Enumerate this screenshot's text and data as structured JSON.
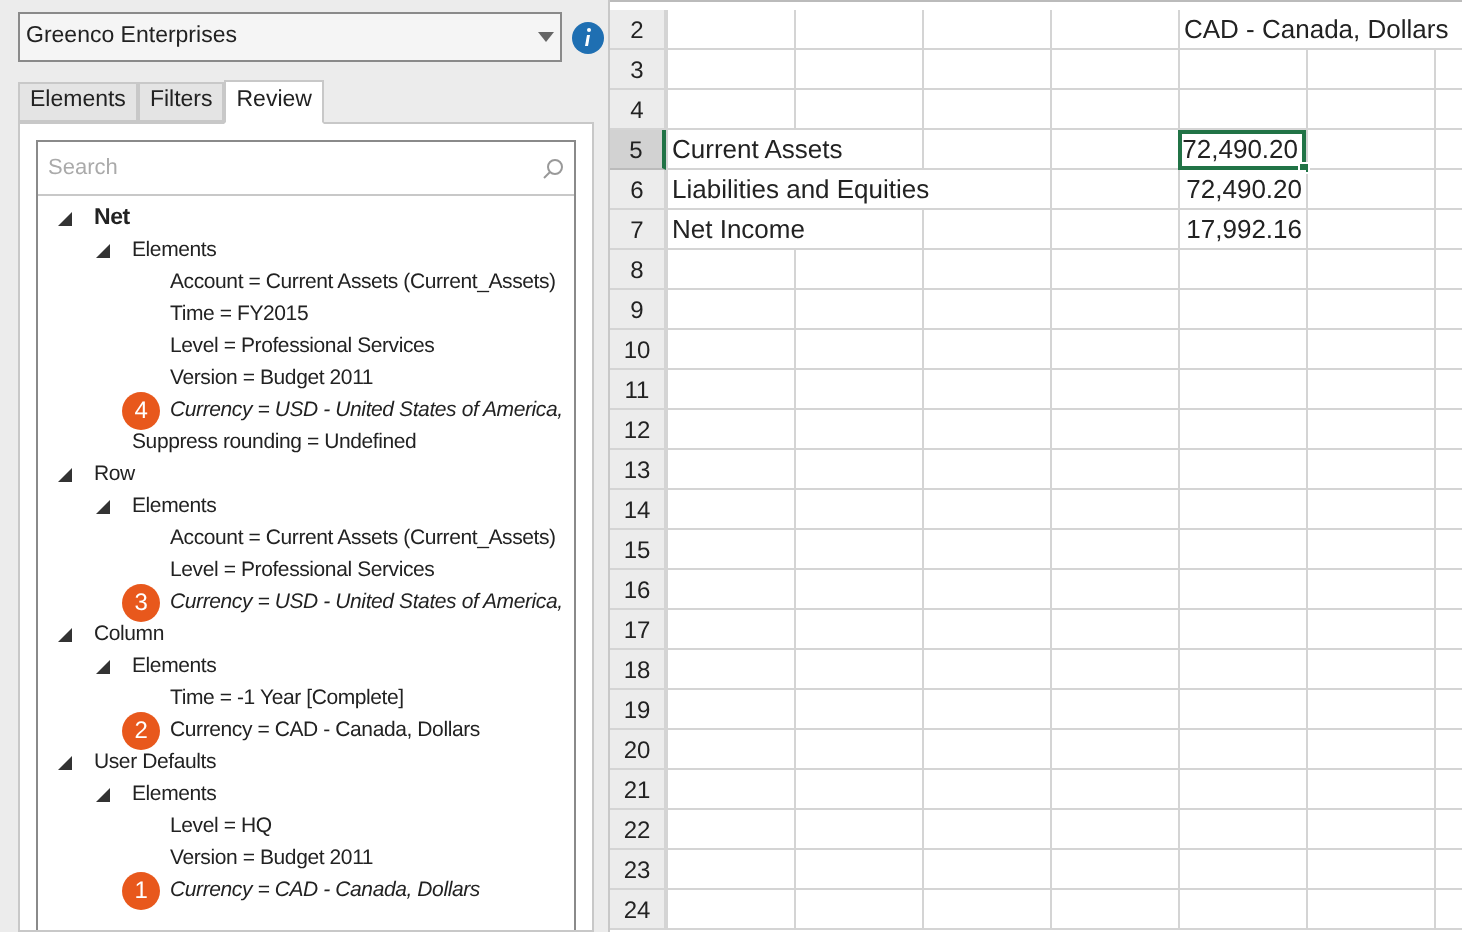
{
  "source_dropdown": {
    "value": "Greenco Enterprises"
  },
  "tabs": [
    {
      "label": "Elements",
      "selected": false
    },
    {
      "label": "Filters",
      "selected": false
    },
    {
      "label": "Review",
      "selected": true
    }
  ],
  "search": {
    "placeholder": "Search"
  },
  "tree": [
    {
      "label": "Net",
      "bold": true,
      "expanded": true,
      "children": [
        {
          "label": "Elements",
          "bold": false,
          "expanded": true,
          "children": [
            {
              "label": "Account = Current Assets (Current_Assets)",
              "italic": false
            },
            {
              "label": "Time = FY2015",
              "italic": false
            },
            {
              "label": "Level = Professional Services",
              "italic": false
            },
            {
              "label": "Version = Budget 2011",
              "italic": false
            },
            {
              "label": "Currency = USD - United States of America,",
              "italic": true,
              "badge": "4"
            }
          ]
        },
        {
          "label": "Suppress rounding = Undefined",
          "italic": false
        }
      ]
    },
    {
      "label": "Row",
      "bold": false,
      "expanded": true,
      "children": [
        {
          "label": "Elements",
          "bold": false,
          "expanded": true,
          "children": [
            {
              "label": "Account = Current Assets (Current_Assets)",
              "italic": false
            },
            {
              "label": "Level = Professional Services",
              "italic": false
            },
            {
              "label": "Currency = USD - United States of America,",
              "italic": true,
              "badge": "3"
            }
          ]
        }
      ]
    },
    {
      "label": "Column",
      "bold": false,
      "expanded": true,
      "children": [
        {
          "label": "Elements",
          "bold": false,
          "expanded": true,
          "children": [
            {
              "label": "Time = -1 Year [Complete]",
              "italic": false
            },
            {
              "label": "Currency = CAD - Canada, Dollars",
              "italic": false,
              "badge": "2"
            }
          ]
        }
      ]
    },
    {
      "label": "User Defaults",
      "bold": false,
      "expanded": true,
      "children": [
        {
          "label": "Elements",
          "bold": false,
          "expanded": true,
          "children": [
            {
              "label": "Level = HQ",
              "italic": false
            },
            {
              "label": "Version = Budget 2011",
              "italic": false
            },
            {
              "label": "Currency = CAD - Canada, Dollars",
              "italic": true,
              "badge": "1"
            }
          ]
        }
      ]
    }
  ],
  "sheet_rows": [
    {
      "number": "2",
      "selected": false,
      "column_5": {
        "text": "CAD - Canada, Dollars",
        "kind": "text",
        "selected": false
      }
    },
    {
      "number": "3",
      "selected": false
    },
    {
      "number": "4",
      "selected": false
    },
    {
      "number": "5",
      "selected": true,
      "column_1": "Current Assets",
      "column_5": {
        "text": "72,490.20",
        "kind": "number",
        "selected": true
      }
    },
    {
      "number": "6",
      "selected": false,
      "column_1": "Liabilities and Equities",
      "column_5": {
        "text": "72,490.20",
        "kind": "number",
        "selected": false
      }
    },
    {
      "number": "7",
      "selected": false,
      "column_1": "Net Income",
      "column_5": {
        "text": "17,992.16",
        "kind": "number",
        "selected": false
      }
    },
    {
      "number": "8",
      "selected": false
    },
    {
      "number": "9",
      "selected": false
    },
    {
      "number": "10",
      "selected": false
    },
    {
      "number": "11",
      "selected": false
    },
    {
      "number": "12",
      "selected": false
    },
    {
      "number": "13",
      "selected": false
    },
    {
      "number": "14",
      "selected": false
    },
    {
      "number": "15",
      "selected": false
    },
    {
      "number": "16",
      "selected": false
    },
    {
      "number": "17",
      "selected": false
    },
    {
      "number": "18",
      "selected": false
    },
    {
      "number": "19",
      "selected": false
    },
    {
      "number": "20",
      "selected": false
    },
    {
      "number": "21",
      "selected": false
    },
    {
      "number": "22",
      "selected": false
    },
    {
      "number": "23",
      "selected": false
    },
    {
      "number": "24",
      "selected": false
    }
  ]
}
